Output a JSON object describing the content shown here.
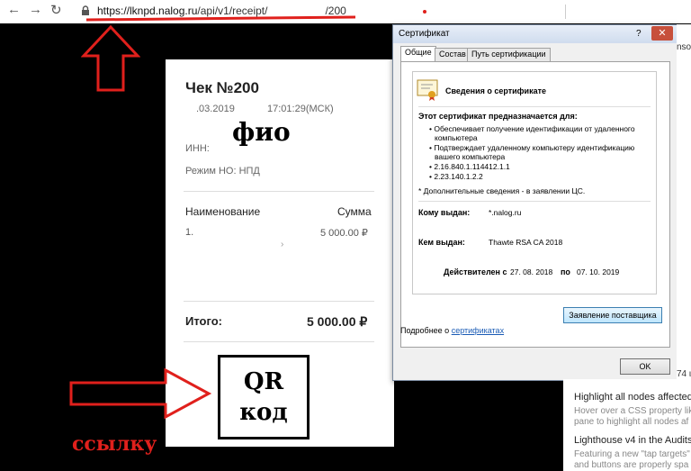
{
  "browser": {
    "back_icon": "back-arrow-icon",
    "url_host": "https://lknpd.nalog.ru",
    "url_path": "/api/v1/receipt/",
    "url_tail": "/200",
    "accent": "#e0201c"
  },
  "receipt": {
    "title": "Чек №200",
    "date": ".03.2019",
    "time": "17:01:29(МСК)",
    "inn_label": "ИНН:",
    "fio": "фио",
    "mode": "Режим НО: НПД",
    "col_name": "Наименование",
    "col_sum": "Сумма",
    "item_num": "1.",
    "item_sum": "5 000.00 ₽",
    "item_sub": "›",
    "total_label": "Итого:",
    "total_sum": "5 000.00 ₽",
    "qr_line1": "QR",
    "qr_line2": "код"
  },
  "annotations": {
    "link_label": "ссылку"
  },
  "cert_dialog": {
    "title": "Сертификат",
    "help": "?",
    "close": "✕",
    "tabs": [
      "Общие",
      "Состав",
      "Путь сертификации"
    ],
    "header": "Сведения о сертификате",
    "purpose_title": "Этот сертификат предназначается для:",
    "purpose_lines": [
      "• Обеспечивает получение идентификации от удаленного",
      "компьютера",
      "• Подтверждает удаленному компьютеру идентификацию",
      "вашего компьютера",
      "• 2.16.840.1.114412.1.1",
      "• 2.23.140.1.2.2"
    ],
    "footnote": "* Дополнительные сведения - в заявлении ЦС.",
    "issued_to_label": "Кому выдан:",
    "issued_to": "*.nalog.ru",
    "issued_by_label": "Кем выдан:",
    "issued_by": "Thawte RSA CA 2018",
    "valid_from_label": "Действителен с",
    "valid_from": "27. 08. 2018",
    "valid_to_label": "по",
    "valid_to": "07. 10. 2019",
    "statement_button": "Заявление поставщика",
    "more_prefix": "Подробнее о",
    "more_link": "сертификатах",
    "ok_button": "OK"
  },
  "devtools": {
    "edge_text": "nso",
    "small_num": "74 ι",
    "item1_title": "Highlight all nodes affected",
    "item1_desc1": "Hover over a CSS property lik",
    "item1_desc2": "pane to highlight all nodes af",
    "item2_title": "Lighthouse v4 in the Audits",
    "item2_desc1": "Featuring a new \"tap targets\"",
    "item2_desc2": "and buttons are properly spa"
  }
}
